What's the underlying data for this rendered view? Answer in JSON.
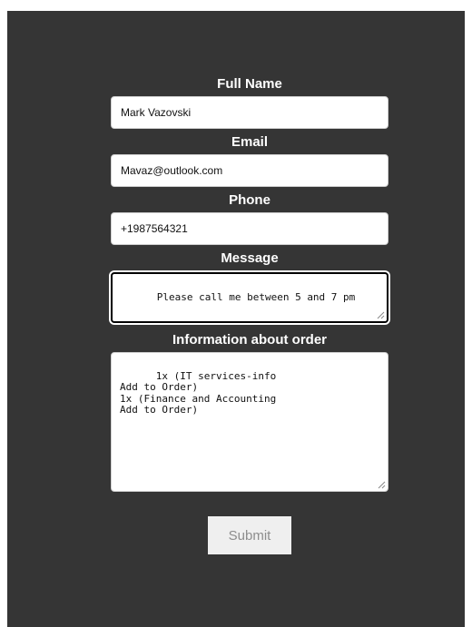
{
  "form": {
    "full_name": {
      "label": "Full Name",
      "value": "Mark Vazovski"
    },
    "email": {
      "label": "Email",
      "value": "Mavaz@outlook.com"
    },
    "phone": {
      "label": "Phone",
      "value": "+1987564321"
    },
    "message": {
      "label": "Message",
      "value": "Please call me between 5 and 7 pm"
    },
    "order_info": {
      "label": "Information about order",
      "value": "1x (IT services-info\nAdd to Order)\n1x (Finance and Accounting\nAdd to Order)"
    },
    "submit_label": "Submit"
  }
}
